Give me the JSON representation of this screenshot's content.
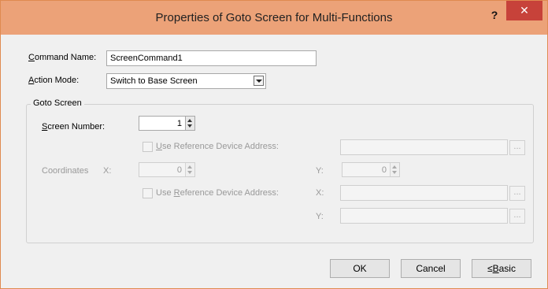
{
  "window": {
    "title": "Properties of Goto Screen for Multi-Functions",
    "help_label": "?",
    "close_label": "✕"
  },
  "command_name": {
    "label_ul": "C",
    "label_rest": "ommand Name:",
    "value": "ScreenCommand1"
  },
  "action_mode": {
    "label_ul": "A",
    "label_rest": "ction Mode:",
    "value": "Switch to Base Screen"
  },
  "goto_screen": {
    "group_label": "Goto Screen",
    "screen_number_ul": "S",
    "screen_number_rest": "creen Number:",
    "screen_number_value": "1",
    "use_ref_1_ul": "U",
    "use_ref_1_rest": "se Reference Device Address:",
    "coordinates_label": "Coordinates",
    "x_label": "X:",
    "x_value": "0",
    "y_label": "Y:",
    "y_value": "0",
    "use_ref_2_pre": "Use ",
    "use_ref_2_ul": "R",
    "use_ref_2_rest": "eference Device Address:",
    "addr_x_label": "X:",
    "addr_y_label": "Y:",
    "browse_label": "..."
  },
  "buttons": {
    "ok": "OK",
    "cancel": "Cancel",
    "basic_pre": "≤",
    "basic_ul": "B",
    "basic_rest": "asic"
  }
}
